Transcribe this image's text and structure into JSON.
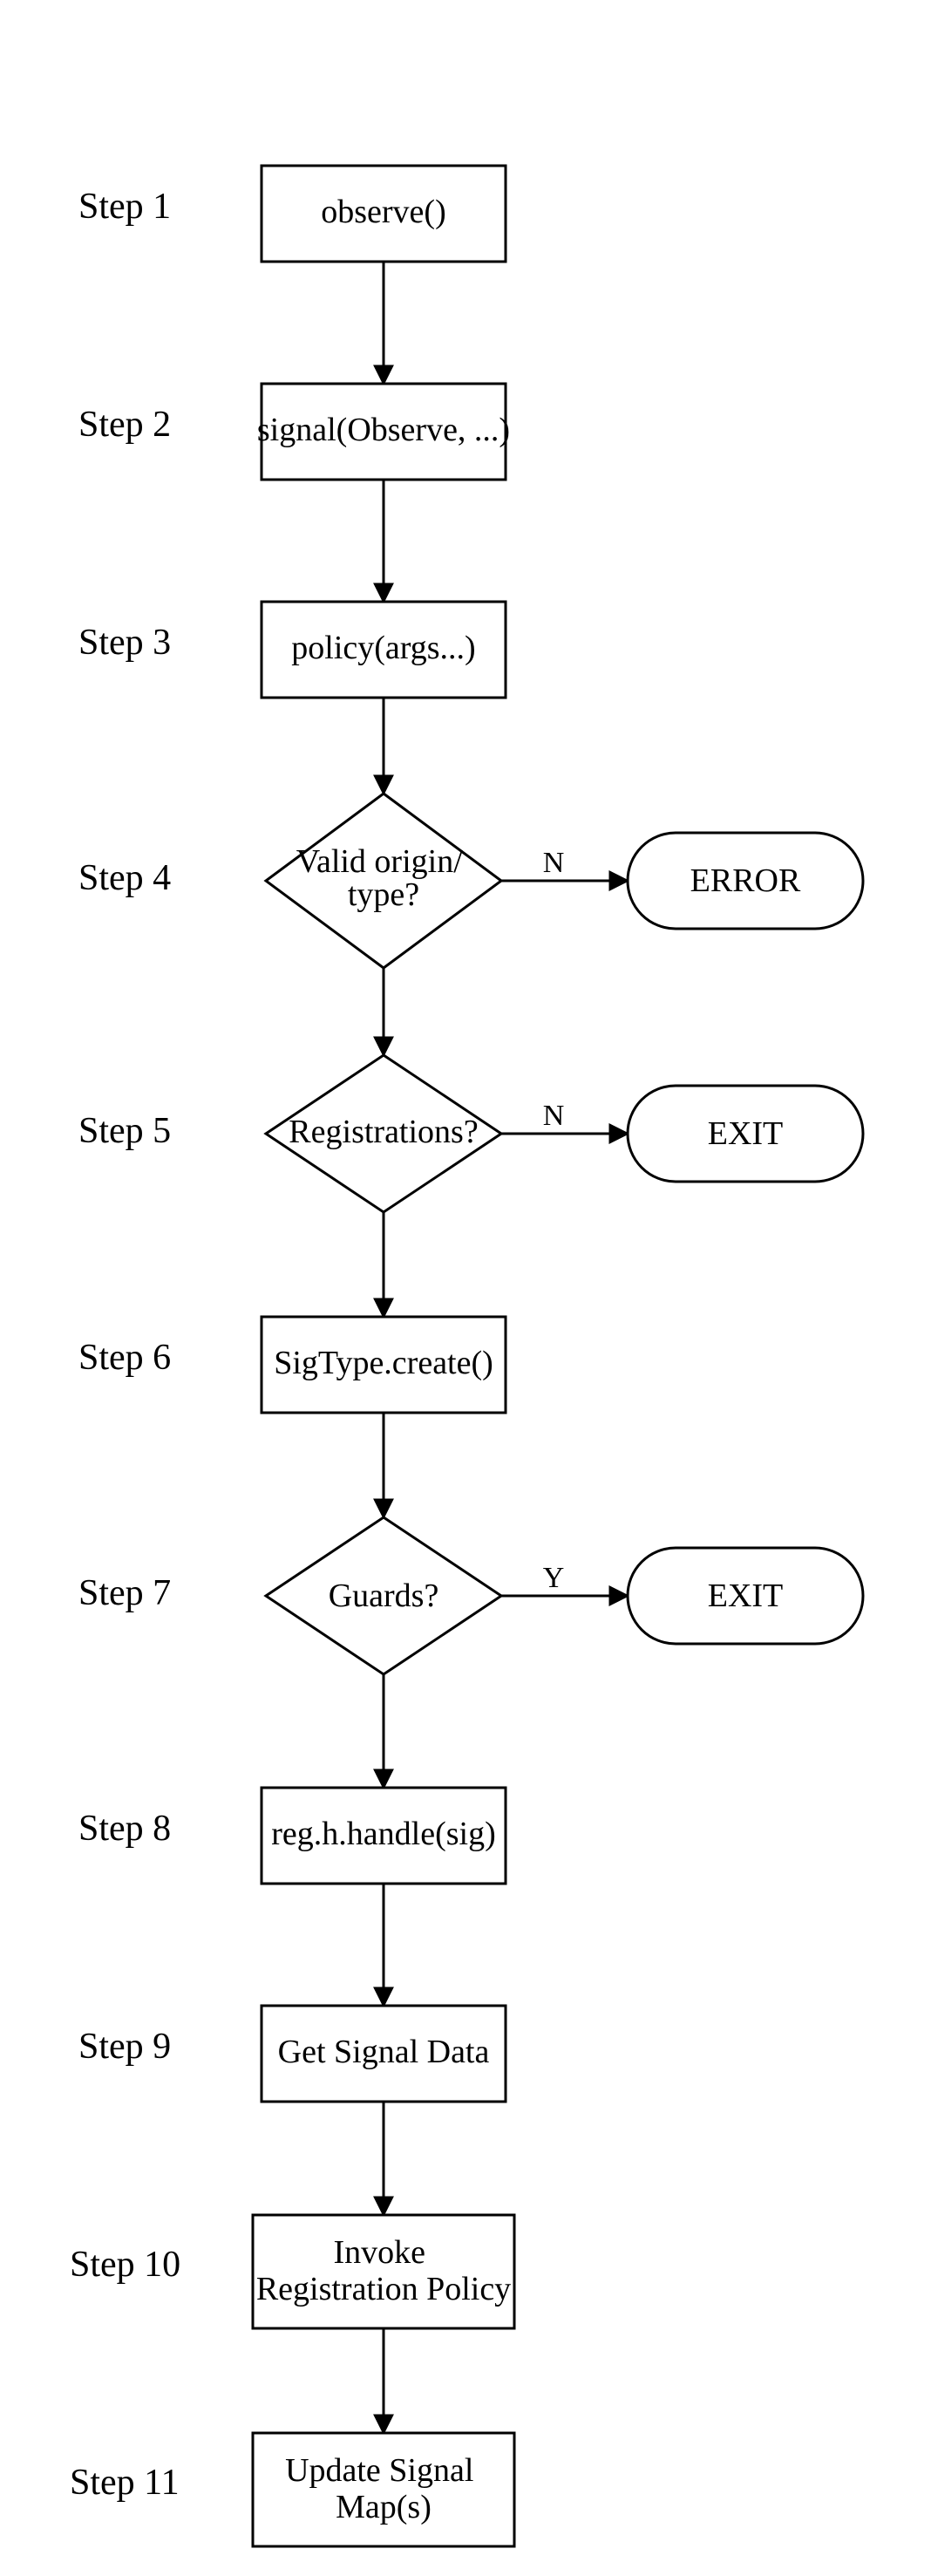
{
  "steps": {
    "s1": {
      "label": "Step 1",
      "node": "observe()"
    },
    "s2": {
      "label": "Step 2",
      "node": "signal(Observe, ...)"
    },
    "s3": {
      "label": "Step 3",
      "node": "policy(args...)"
    },
    "s4": {
      "label": "Step 4",
      "node": "Valid origin/\ntype?",
      "edge": "N",
      "term": "ERROR"
    },
    "s5": {
      "label": "Step 5",
      "node": "Registrations?",
      "edge": "N",
      "term": "EXIT"
    },
    "s6": {
      "label": "Step 6",
      "node": "SigType.create()"
    },
    "s7": {
      "label": "Step 7",
      "node": "Guards?",
      "edge": "Y",
      "term": "EXIT"
    },
    "s8": {
      "label": "Step 8",
      "node": "reg.h.handle(sig)"
    },
    "s9": {
      "label": "Step 9",
      "node": "Get Signal Data"
    },
    "s10": {
      "label": "Step 10",
      "node": "Invoke\nRegistration Policy"
    },
    "s11": {
      "label": "Step 11",
      "node": "Update Signal\nMap(s)"
    }
  }
}
